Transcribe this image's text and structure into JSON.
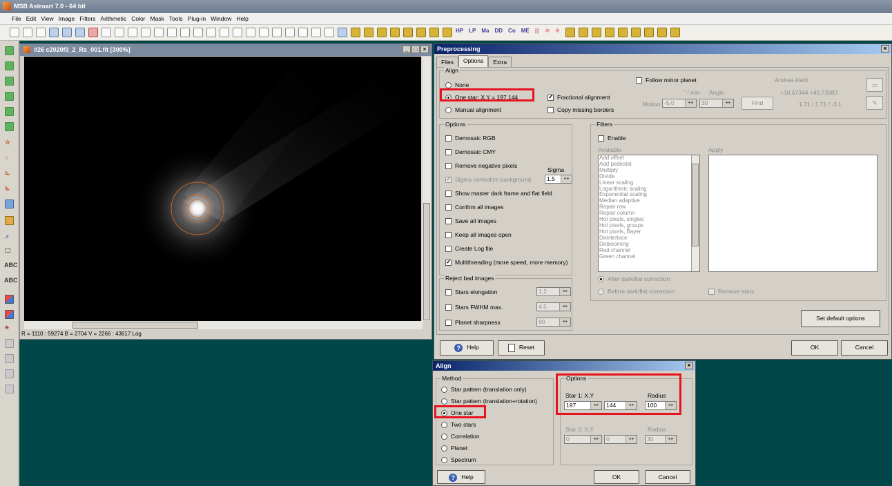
{
  "app": {
    "title": "MSB Astroart 7.0 - 64 bit"
  },
  "menu": [
    "File",
    "Edit",
    "View",
    "Image",
    "Filters",
    "Arithmetic",
    "Color",
    "Mask",
    "Tools",
    "Plug-in",
    "Window",
    "Help"
  ],
  "toolbar_text": [
    "HP",
    "LP",
    "Ma",
    "DD",
    "Co",
    "ME"
  ],
  "left_toolbar_text": [
    "ABC",
    "ABC"
  ],
  "image_window": {
    "title": "#26 c2020f3_2_Rs_001.fit [300%]",
    "status": "R = 1110 : 59274   B = 2704   V = 2266 : 43617 Log"
  },
  "preprocessing": {
    "title": "Preprocessing",
    "tabs": [
      "Files",
      "Options",
      "Extra"
    ],
    "align": {
      "label": "Align",
      "none": "None",
      "one_star": "One star: X,Y = 197,144",
      "manual": "Manual alignment",
      "fractional": "Fractional alignment",
      "copy_missing": "Copy missing borders",
      "follow_minor": "Follow minor planet",
      "author": "Andrea Aletti",
      "per_min": "\" / min",
      "angle": "Angle",
      "motion": "Motion",
      "motion_value": "-5.0",
      "angle_value": "30",
      "find": "Find",
      "coords": "+10.67344  +43.73683",
      "coords2": "1.71 / 1.71 / -3.1"
    },
    "options": {
      "label": "Options",
      "items": [
        "Demosaic RGB",
        "Demosaic CMY",
        "Remove negative pixels",
        "Sigma normalize background",
        "Show master dark frame and flat field",
        "Confirm all images",
        "Save all images",
        "Keep all images open",
        "Create Log file",
        "Multithreading (more speed, more memory)"
      ],
      "sigma_label": "Sigma",
      "sigma_value": "1.5"
    },
    "reject": {
      "label": "Reject bad images",
      "items": [
        "Stars elongation",
        "Stars FWHM max.",
        "Planet sharpness"
      ],
      "values": [
        "1.2",
        "4.5",
        "80"
      ]
    },
    "filters": {
      "label": "Filters",
      "enable": "Enable",
      "available": "Available",
      "apply": "Apply",
      "list": [
        "Add offset",
        "Add pedestal",
        "Multiply",
        "Divide",
        "Linear scaling",
        "Logarithmic scaling",
        "Exponential scaling",
        "Median adaptive",
        "Repair row",
        "Repair column",
        "Hot pixels, singles",
        "Hot pixels, groups",
        "Hot pixels, Bayer",
        "Deinterlace",
        "Deblooming",
        "Red channel",
        "Green channel"
      ],
      "after": "After dark/flat correction",
      "before": "Before dark/flat correction",
      "remove_stars": "Remove stars"
    },
    "set_default": "Set default options",
    "help": "Help",
    "reset": "Reset",
    "ok": "OK",
    "cancel": "Cancel"
  },
  "align_dialog": {
    "title": "Align",
    "method_label": "Method",
    "methods": [
      "Star pattern (translation only)",
      "Star pattern (translation+rotation)",
      "One star",
      "Two stars",
      "Correlation",
      "Planet",
      "Spectrum"
    ],
    "options_label": "Options",
    "star1": "Star 1: X,Y",
    "radius": "Radius",
    "star1_x": "197",
    "star1_y": "144",
    "radius1": "100",
    "star2": "Star 2: X,Y",
    "radius2_label": "Radius",
    "star2_x": "0",
    "star2_y": "0",
    "radius2": "30",
    "help": "Help",
    "ok": "OK",
    "cancel": "Cancel"
  }
}
